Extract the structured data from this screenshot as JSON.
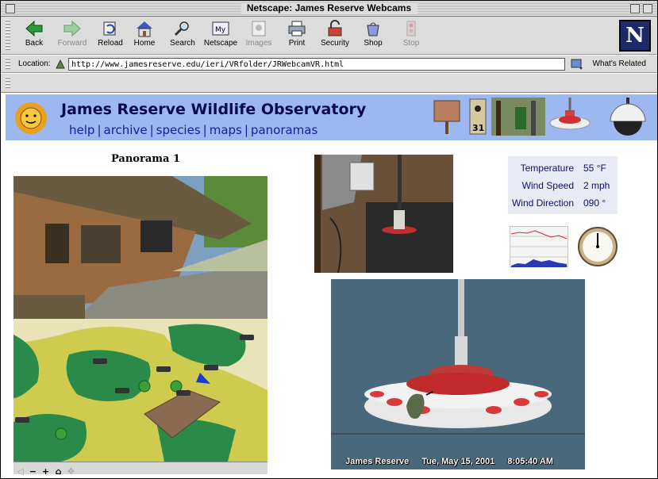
{
  "window": {
    "title": "Netscape: James Reserve Webcams"
  },
  "toolbar": {
    "buttons": [
      {
        "label": "Back",
        "icon": "back-arrow-icon",
        "enabled": true
      },
      {
        "label": "Forward",
        "icon": "forward-arrow-icon",
        "enabled": false
      },
      {
        "label": "Reload",
        "icon": "reload-icon",
        "enabled": true
      },
      {
        "label": "Home",
        "icon": "home-icon",
        "enabled": true
      },
      {
        "label": "Search",
        "icon": "search-icon",
        "enabled": true
      },
      {
        "label": "Netscape",
        "icon": "netscape-icon",
        "enabled": true
      },
      {
        "label": "Images",
        "icon": "images-icon",
        "enabled": false
      },
      {
        "label": "Print",
        "icon": "printer-icon",
        "enabled": true
      },
      {
        "label": "Security",
        "icon": "lock-icon",
        "enabled": true
      },
      {
        "label": "Shop",
        "icon": "shop-icon",
        "enabled": true
      },
      {
        "label": "Stop",
        "icon": "stop-icon",
        "enabled": false
      }
    ],
    "logo": "N"
  },
  "location": {
    "label": "Location:",
    "url": "http://www.jamesreserve.edu/ieri/VRfolder/JRWebcamVR.html",
    "whats_related": "What's Related"
  },
  "page": {
    "site_title": "James Reserve Wildlife Observatory",
    "nav": [
      "help",
      "archive",
      "species",
      "maps",
      "panoramas"
    ],
    "panorama_title": "Panorama 1",
    "weather": [
      {
        "label": "Temperature",
        "value": "55 °F"
      },
      {
        "label": "Wind Speed",
        "value": "2 mph"
      },
      {
        "label": "Wind Direction",
        "value": "090 °"
      }
    ],
    "banner_badge": "31",
    "map_controls": [
      "◁",
      "−",
      "+",
      "⌂",
      "✥"
    ],
    "camera_caption": {
      "location": "James Reserve",
      "date": "Tue, May 15, 2001",
      "time": "8:05:40 AM"
    }
  },
  "colors": {
    "banner": "#9db8f0",
    "nav_link": "#1a1aa0",
    "title": "#0a0a50"
  }
}
